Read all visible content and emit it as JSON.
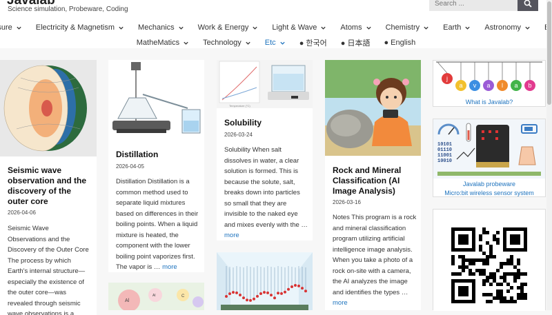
{
  "site": {
    "title": "Javalab",
    "tagline": "Science simulation, Probeware, Coding"
  },
  "search": {
    "placeholder": "Search ..."
  },
  "nav": {
    "row1": [
      {
        "label": "Measure",
        "dropdown": true
      },
      {
        "label": "Electricity & Magnetism",
        "dropdown": true
      },
      {
        "label": "Mechanics",
        "dropdown": true
      },
      {
        "label": "Work & Energy",
        "dropdown": true
      },
      {
        "label": "Light & Wave",
        "dropdown": true
      },
      {
        "label": "Atoms",
        "dropdown": true
      },
      {
        "label": "Chemistry",
        "dropdown": true
      },
      {
        "label": "Earth",
        "dropdown": true
      },
      {
        "label": "Astronomy",
        "dropdown": true
      },
      {
        "label": "Biology",
        "dropdown": false
      }
    ],
    "row2": [
      {
        "label": "MatheMatics",
        "dropdown": true
      },
      {
        "label": "Technology",
        "dropdown": true
      },
      {
        "label": "Etc",
        "dropdown": true
      },
      {
        "label": "● 한국어",
        "dropdown": false
      },
      {
        "label": "● 日本語",
        "dropdown": false
      },
      {
        "label": "● English",
        "dropdown": false
      }
    ],
    "active": "Etc"
  },
  "posts": [
    {
      "title": "Seismic wave observation and the discovery of the outer core",
      "date": "2026-04-06",
      "excerpt": "Seismic Wave Observations and the Discovery of the Outer Core The process by which Earth's internal structure—especially the existence of the outer core—was revealed through seismic wave observations is a major discovery in Earth",
      "more": ""
    },
    {
      "title": "Distillation",
      "date": "2026-04-05",
      "excerpt": "Distillation Distillation is a common method used to separate liquid mixtures based on differences in their boiling points. When a liquid mixture is heated, the component with the lower boiling point vaporizes first. The vapor is …",
      "more": "more"
    },
    {
      "title": "Solubility",
      "date": "2026-03-24",
      "excerpt": "Solubility When salt dissolves in water, a clear solution is formed. This is because the solute, salt, breaks down into particles so small that they are invisible to the naked eye and mixes evenly with the …",
      "more": "more"
    },
    {
      "title": "Rock and Mineral Classification (AI Image Analysis)",
      "date": "2026-03-16",
      "excerpt": "Notes This program is a rock and mineral classification program utilizing artificial intelligence image analysis. When you take a photo of a rock on-site with a camera, the AI analyzes the image and identifies the types …",
      "more": "more"
    }
  ],
  "sidebar": {
    "about_caption": "What is Javalab?",
    "about_letters": [
      "j",
      "a",
      "v",
      "a",
      "l",
      "a",
      "b"
    ],
    "probeware_caption_1": "Javalab probeware",
    "probeware_caption_2": "Micro:bit wireless sensor system",
    "binary_lines": [
      "10101",
      "01110",
      "11001",
      "10010"
    ]
  },
  "thumb_labels": {
    "periodic": [
      "Al",
      "Al",
      "C"
    ],
    "solubility_axis": "Temperature (°C)"
  },
  "colors": {
    "link": "#1e73be",
    "search_button": "#55555e",
    "background": "#f7f7f7"
  }
}
